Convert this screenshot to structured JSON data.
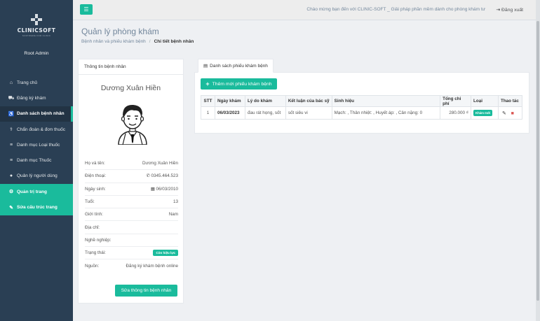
{
  "brand": {
    "name": "CLINICSOFT",
    "tagline": "SOFTWARE FOR CLINIC"
  },
  "user": {
    "name": "Root Admin"
  },
  "sidebar": {
    "items": [
      {
        "label": "Trang chủ",
        "icon": "home-icon",
        "glyph": "⌂"
      },
      {
        "label": "Đăng ký khám",
        "icon": "cart-icon",
        "glyph": "🛒"
      },
      {
        "label": "Danh sách bệnh nhân",
        "icon": "wheelchair-icon",
        "glyph": "♿"
      },
      {
        "label": "Chẩn đoán & đơn thuốc",
        "icon": "stethoscope-icon",
        "glyph": "⚕"
      },
      {
        "label": "Danh mục Loại thuốc",
        "icon": "list-icon",
        "glyph": "≡"
      },
      {
        "label": "Danh mục Thuốc",
        "icon": "list-icon",
        "glyph": "≡"
      },
      {
        "label": "Quản lý người dùng",
        "icon": "user-icon",
        "glyph": "👤"
      },
      {
        "label": "Quản trị trang",
        "icon": "gear-icon",
        "glyph": "⚙"
      },
      {
        "label": "Sửa cấu trúc trang",
        "icon": "wrench-icon",
        "glyph": "🔧"
      }
    ]
  },
  "topbar": {
    "welcome": "Chào mừng bạn đến với CLINIC-SOFT _ Giải pháp phần mềm dành cho phòng khám tư",
    "logout": "Đăng xuất"
  },
  "page": {
    "title": "Quản lý phòng khám",
    "breadcrumb": [
      "Bệnh nhân và phiếu khám bệnh",
      "Chi tiết bệnh nhân"
    ]
  },
  "patient_card": {
    "header": "Thông tin bệnh nhân",
    "name": "Dương Xuân Hiền",
    "fields": [
      {
        "label": "Họ và tên:",
        "value": "Dương Xuân Hiền"
      },
      {
        "label": "Điện thoại:",
        "value": "0345.464.523",
        "icon": "phone-icon"
      },
      {
        "label": "Ngày sinh:",
        "value": "06/03/2010",
        "icon": "calendar-icon"
      },
      {
        "label": "Tuổi:",
        "value": "13"
      },
      {
        "label": "Giới tính:",
        "value": "Nam"
      },
      {
        "label": "Địa chỉ:",
        "value": ""
      },
      {
        "label": "Nghề nghiệp:",
        "value": ""
      },
      {
        "label": "Trạng thái:",
        "value": "Còn hiệu lực",
        "badge": true
      },
      {
        "label": "Nguồn:",
        "value": "Đăng ký khám bệnh online"
      }
    ],
    "edit_button": "Sửa thông tin bệnh nhân"
  },
  "records": {
    "tab": "Danh sách phiếu khám bệnh",
    "add_button": "Thêm mới phiếu khám bệnh",
    "columns": [
      "STT",
      "Ngày khám",
      "Lý do khám",
      "Kết luận của bác sỹ",
      "Sinh hiệu",
      "Tổng chi phí",
      "Loại",
      "Thao tác"
    ],
    "rows": [
      {
        "stt": "1",
        "date": "06/03/2023",
        "reason": "đau rát họng, sốt",
        "conclusion": "sốt siêu vi",
        "vitals": "Mạch: , Thân nhiệt: , Huyết áp: , Cân nặng: 0",
        "total": "280.000 ₫",
        "type": "Khám mới"
      }
    ]
  },
  "colors": {
    "accent": "#1abb9c",
    "sidebar": "#2a3f54",
    "danger": "#d9534f"
  }
}
